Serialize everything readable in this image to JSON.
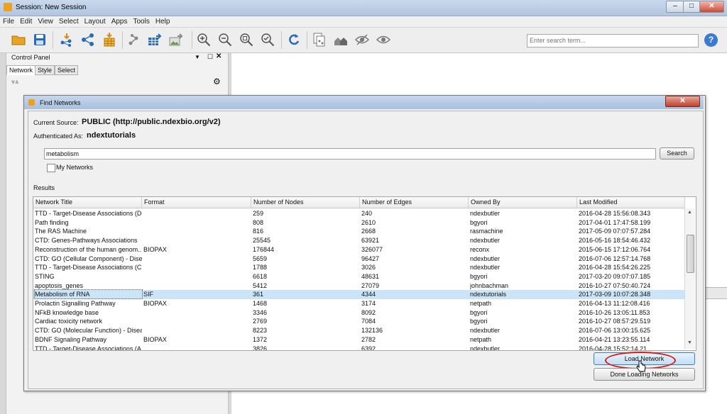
{
  "window": {
    "title": "Session: New Session"
  },
  "menu": [
    "File",
    "Edit",
    "View",
    "Select",
    "Layout",
    "Apps",
    "Tools",
    "Help"
  ],
  "toolbar": {
    "search_placeholder": "Enter search term...",
    "icons": [
      "open-folder-icon",
      "save-icon",
      "import-network-icon",
      "import-network-file-icon",
      "import-table-icon",
      "export-network-icon",
      "export-table-icon",
      "export-image-icon",
      "zoom-in-icon",
      "zoom-out-icon",
      "zoom-fit-icon",
      "zoom-selected-icon",
      "refresh-icon",
      "new-network-from-selection-icon",
      "first-neighbors-icon",
      "hide-selected-icon",
      "show-all-icon"
    ]
  },
  "control_panel": {
    "title": "Control Panel",
    "tabs": [
      "Network",
      "Style",
      "Select"
    ]
  },
  "dialog": {
    "title": "Find Networks",
    "source_label": "Current Source:",
    "source_value": "PUBLIC (http://public.ndexbio.org/v2)",
    "auth_label": "Authenticated As:",
    "auth_value": "ndextutorials",
    "query": "metabolism",
    "search_button": "Search",
    "my_networks_label": "My Networks",
    "results_label": "Results",
    "load_button": "Load Network",
    "done_button": "Done Loading Networks"
  },
  "table": {
    "columns": [
      "Network Title",
      "Format",
      "Number of Nodes",
      "Number of Edges",
      "Owned By",
      "Last Modified"
    ],
    "rows": [
      [
        "TTD - Target-Disease Associations (D...",
        "",
        "259",
        "240",
        "ndexbutler",
        "2016-04-28 15:56:08.343"
      ],
      [
        "Path finding",
        "",
        "808",
        "2610",
        "bgyori",
        "2017-04-01 17:47:58.199"
      ],
      [
        "The RAS Machine",
        "",
        "816",
        "2668",
        "rasmachine",
        "2017-05-09 07:07:57.284"
      ],
      [
        "CTD: Genes-Pathways Associations",
        "",
        "25545",
        "63921",
        "ndexbutler",
        "2016-05-16 18:54:46.432"
      ],
      [
        "Reconstruction of the human genom...",
        "BIOPAX",
        "176844",
        "326077",
        "reconx",
        "2015-06-15 17:12:06.764"
      ],
      [
        "CTD: GO (Cellular Component) - Dise...",
        "",
        "5659",
        "96427",
        "ndexbutler",
        "2016-07-06 12:57:14.768"
      ],
      [
        "TTD - Target-Disease Associations (C...",
        "",
        "1788",
        "3026",
        "ndexbutler",
        "2016-04-28 15:54:26.225"
      ],
      [
        "STING",
        "",
        "6618",
        "48631",
        "bgyori",
        "2017-03-20 09:07:07.185"
      ],
      [
        "apoptosis_genes",
        "",
        "5412",
        "27079",
        "johnbachman",
        "2016-10-27 07:50:40.724"
      ],
      [
        "Metabolism of RNA",
        "SIF",
        "361",
        "4344",
        "ndextutorials",
        "2017-03-09 10:07:28.348"
      ],
      [
        "Prolactin Signalling Pathway",
        "BIOPAX",
        "1468",
        "3174",
        "netpath",
        "2016-04-13 11:12:08.416"
      ],
      [
        "NFkB knowledge base",
        "",
        "3346",
        "8092",
        "bgyori",
        "2016-10-26 13:05:11.853"
      ],
      [
        "Cardiac toxicity network",
        "",
        "2769",
        "7084",
        "bgyori",
        "2016-10-27 08:57:29.519"
      ],
      [
        "CTD: GO (Molecular Function) - Disea...",
        "",
        "8223",
        "132136",
        "ndexbutler",
        "2016-07-06 13:00:15.625"
      ],
      [
        "BDNF Signaling Pathway",
        "BIOPAX",
        "1372",
        "2782",
        "netpath",
        "2016-04-21 13:23:55.114"
      ],
      [
        "TTD - Target-Disease Associations (A...",
        "",
        "3826",
        "6392",
        "ndexbutler",
        "2016-04-28 15:52:14.21"
      ]
    ],
    "selected_row": 9
  }
}
